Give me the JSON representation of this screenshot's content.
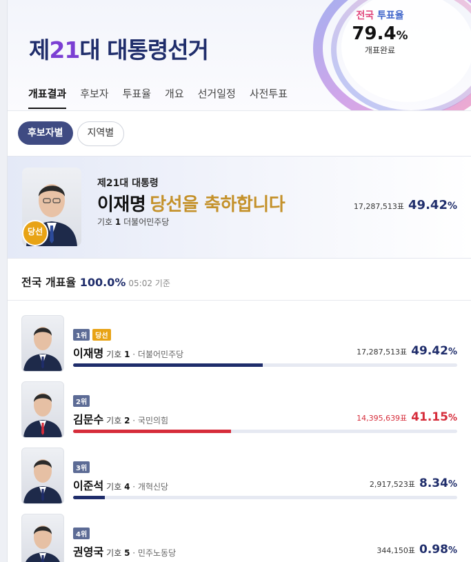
{
  "header": {
    "title_prefix": "제",
    "title_number": "21",
    "title_suffix": "대 대통령선거",
    "turnout_label_a": "전국",
    "turnout_label_b": "투표율",
    "turnout_value": "79.4",
    "turnout_unit": "%",
    "turnout_sub": "개표완료"
  },
  "nav": {
    "tabs": [
      {
        "label": "개표결과",
        "active": true
      },
      {
        "label": "후보자"
      },
      {
        "label": "투표율"
      },
      {
        "label": "개요"
      },
      {
        "label": "선거일정"
      },
      {
        "label": "사전투표"
      }
    ]
  },
  "segment": {
    "by_candidate": "후보자별",
    "by_region": "지역별"
  },
  "banner": {
    "subtitle": "제21대 대통령",
    "name": "이재명",
    "congrats": "당선을 축하합니다",
    "symbol_label": "기호",
    "symbol_number": "1",
    "party": "더불어민주당",
    "votes": "17,287,513표",
    "pct": "49.42",
    "pct_unit": "%",
    "win_badge": "당선"
  },
  "count": {
    "label": "전국 개표율",
    "value": "100.0",
    "unit": "%",
    "time": "05:02 기준"
  },
  "candidates": [
    {
      "rank": "1위",
      "win": "당선",
      "name": "이재명",
      "symbol_label": "기호",
      "number": "1",
      "party": "더불어민주당",
      "votes": "17,287,513표",
      "pct": "49.42",
      "unit": "%",
      "color": "#1f2d6b",
      "votecolor": "#333333",
      "share": 49.42
    },
    {
      "rank": "2위",
      "name": "김문수",
      "symbol_label": "기호",
      "number": "2",
      "party": "국민의힘",
      "votes": "14,395,639표",
      "pct": "41.15",
      "unit": "%",
      "color": "#d62c3a",
      "votecolor": "#d62c3a",
      "share": 41.15
    },
    {
      "rank": "3위",
      "name": "이준석",
      "symbol_label": "기호",
      "number": "4",
      "party": "개혁신당",
      "votes": "2,917,523표",
      "pct": "8.34",
      "unit": "%",
      "color": "#1f2d6b",
      "votecolor": "#333333",
      "share": 8.34
    },
    {
      "rank": "4위",
      "name": "권영국",
      "symbol_label": "기호",
      "number": "5",
      "party": "민주노동당",
      "votes": "344,150표",
      "pct": "0.98",
      "unit": "%",
      "color": "#1f2d6b",
      "votecolor": "#333333",
      "share": 0.98
    }
  ]
}
